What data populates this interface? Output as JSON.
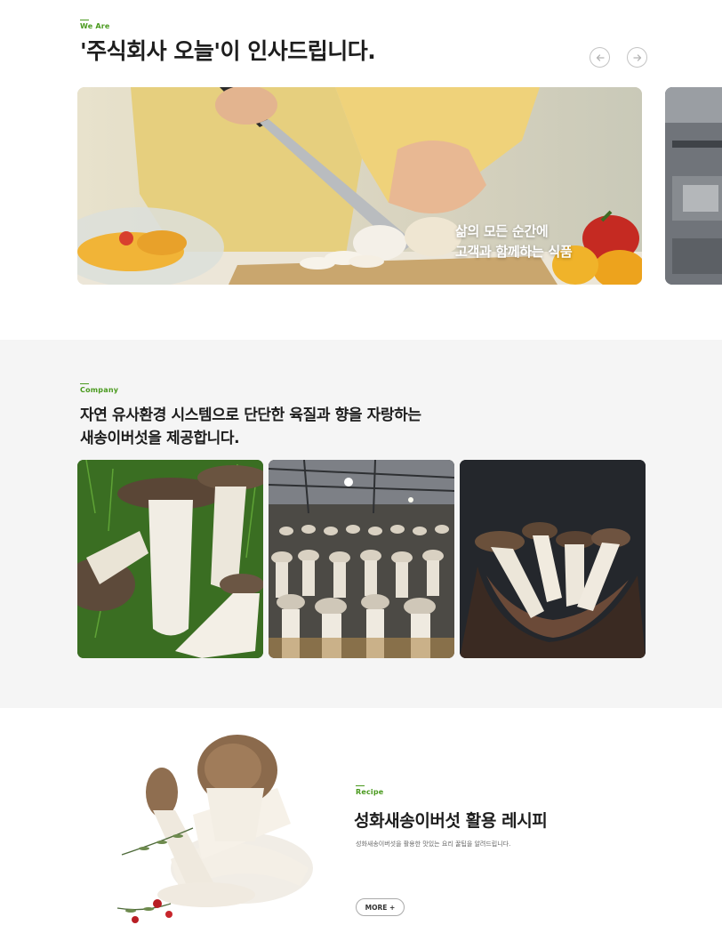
{
  "greeting": {
    "eyebrow": "We Are",
    "title": "'주식회사 오늘'이 인사드립니다.",
    "prev_icon": "arrow-left-circle-icon",
    "next_icon": "arrow-right-circle-icon",
    "slide_caption_line1": "삶의 모든 순간에",
    "slide_caption_line2": "고객과 함께하는 식품"
  },
  "company": {
    "eyebrow": "Company",
    "title_line1": "자연 유사환경 시스템으로 단단한 육질과 향을 자랑하는",
    "title_line2": "새송이버섯을 제공합니다."
  },
  "recipe": {
    "eyebrow": "Recipe",
    "title": "성화새송이버섯 활용 레시피",
    "description": "성화새송이버섯을 활용한 맛있는 요리 꿀팁을 알려드립니다.",
    "more_label": "MORE +"
  },
  "colors": {
    "accent": "#4a9a1e",
    "text_dark": "#1d1d1d",
    "section_bg": "#f5f5f5"
  }
}
